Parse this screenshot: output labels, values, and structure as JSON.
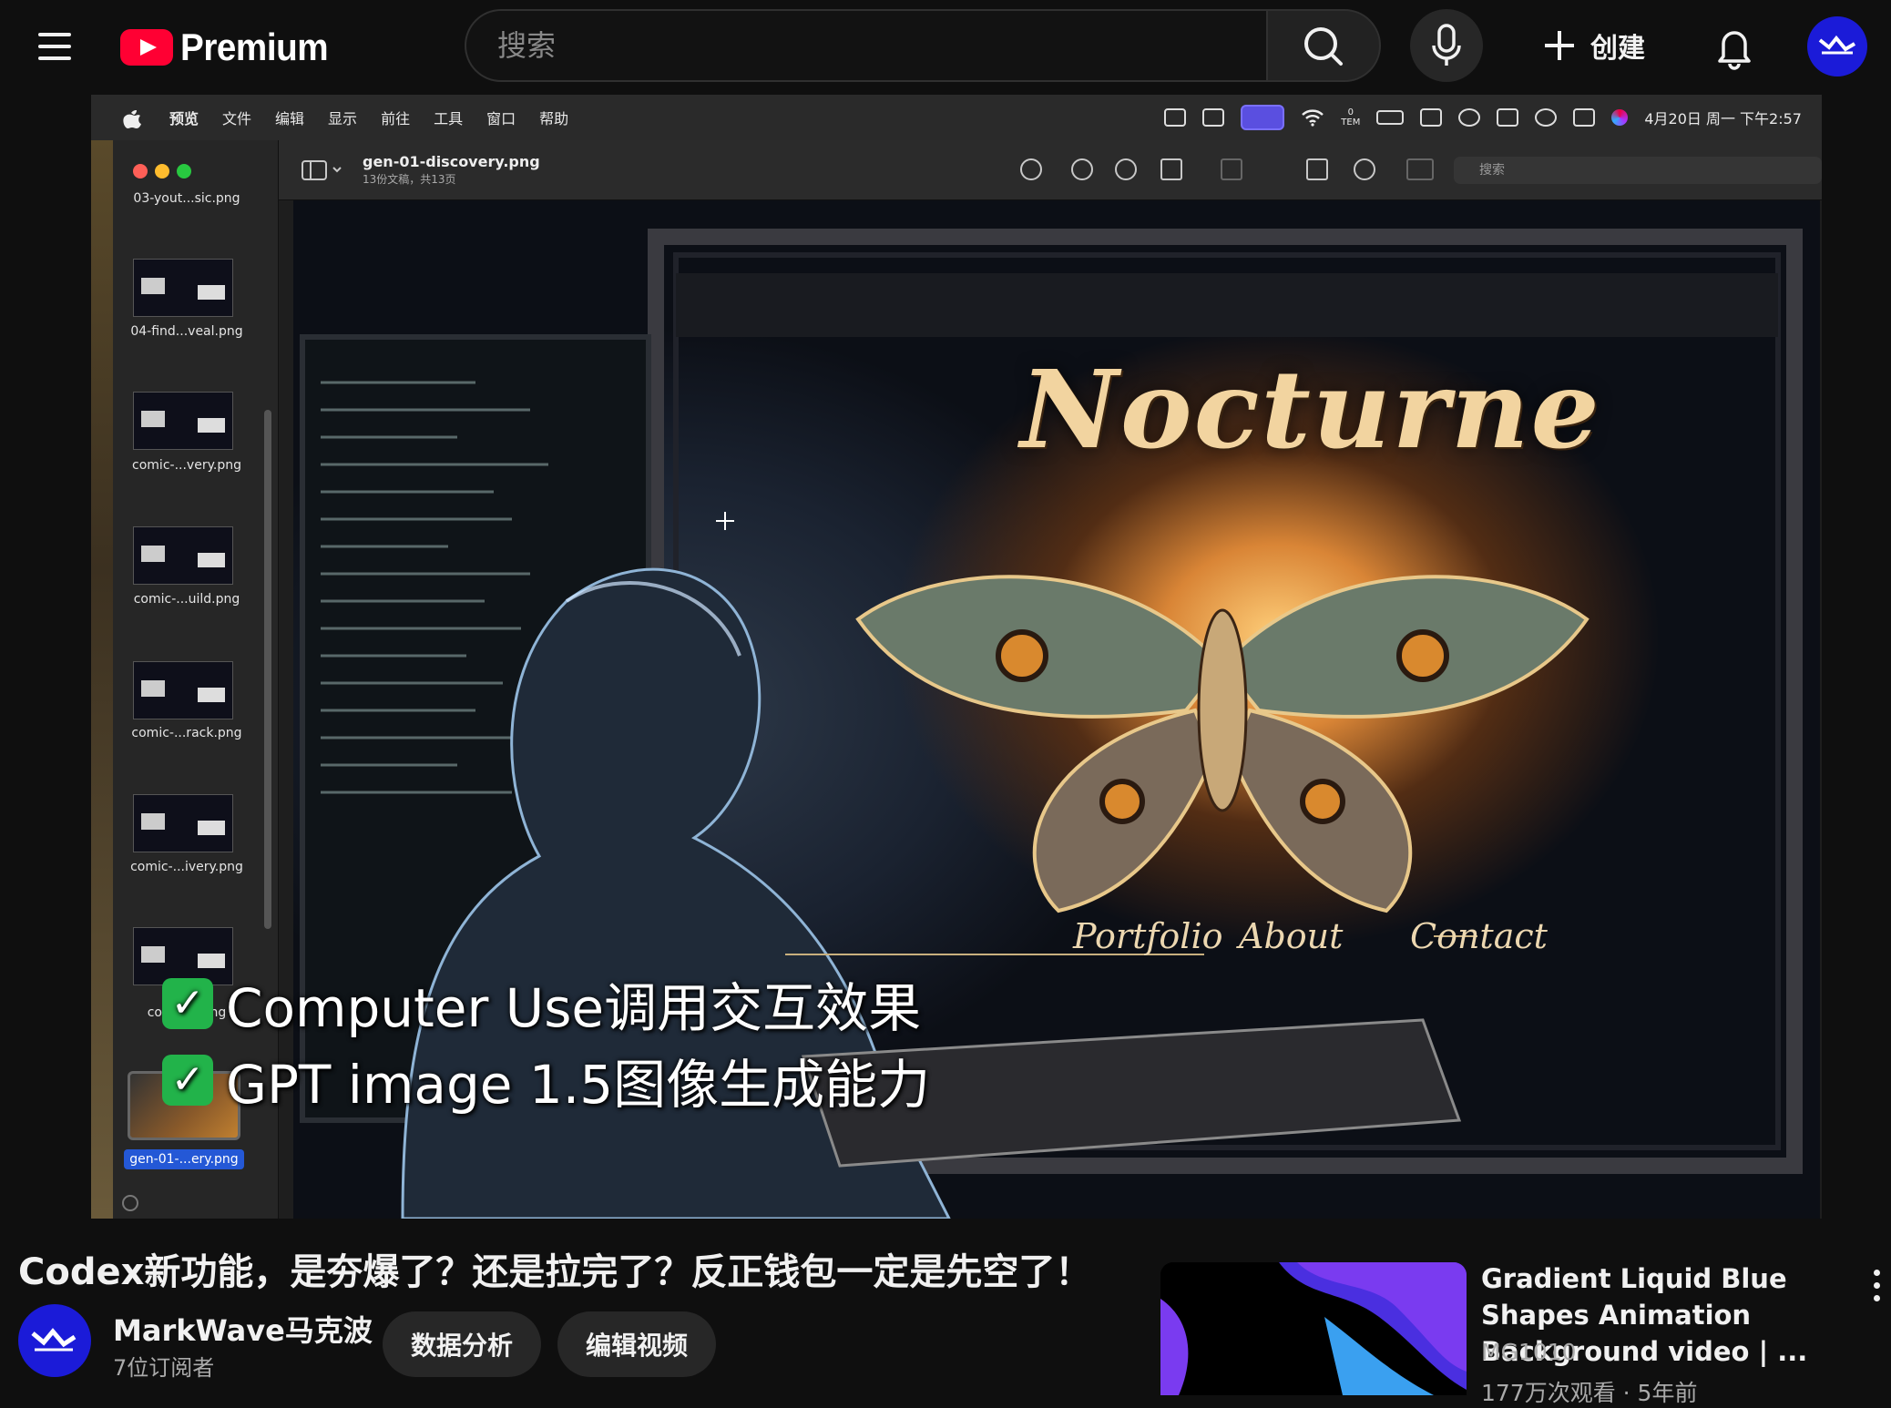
{
  "header": {
    "logo_text": "Premium",
    "search_placeholder": "搜索",
    "create_label": "创建"
  },
  "mac": {
    "menu": [
      "预览",
      "文件",
      "编辑",
      "显示",
      "前往",
      "工具",
      "窗口",
      "帮助"
    ],
    "temp_top": "0",
    "temp_bottom": "TEM",
    "datetime": "4月20日 周一 下午2:57"
  },
  "preview": {
    "doc_title": "gen-01-discovery.png",
    "doc_subtitle": "13份文稿，共13页",
    "search_placeholder": "搜索",
    "thumbnails": [
      {
        "label": "03-yout...sic.png"
      },
      {
        "label": "04-find...veal.png"
      },
      {
        "label": "comic-...very.png"
      },
      {
        "label": "comic-...uild.png"
      },
      {
        "label": "comic-...rack.png"
      },
      {
        "label": "comic-...ivery.png"
      },
      {
        "label": "comic-...png"
      }
    ],
    "selected_label": "gen-01-...ery.png"
  },
  "artwork": {
    "title": "Nocturne",
    "nav": [
      "Portfolio",
      "About",
      "Contact"
    ]
  },
  "captions": {
    "line1": "Computer Use调用交互效果",
    "line2": "GPT image 1.5图像生成能力",
    "check": "✓"
  },
  "video": {
    "title": "Codex新功能，是夯爆了？还是拉完了？反正钱包一定是先空了！",
    "channel_name": "MarkWave马克波",
    "subscribers": "7位订阅者",
    "analytics_label": "数据分析",
    "edit_label": "编辑视频"
  },
  "recommendation": {
    "title": "Gradient Liquid Blue Shapes Animation Background video | ...",
    "channel": "MG1010",
    "meta": "177万次观看 · 5年前"
  },
  "colors": {
    "youtube_red": "#ff0033",
    "avatar_blue": "#1b1bd8",
    "selection_blue": "#2458d6",
    "check_green": "#22b34a"
  }
}
